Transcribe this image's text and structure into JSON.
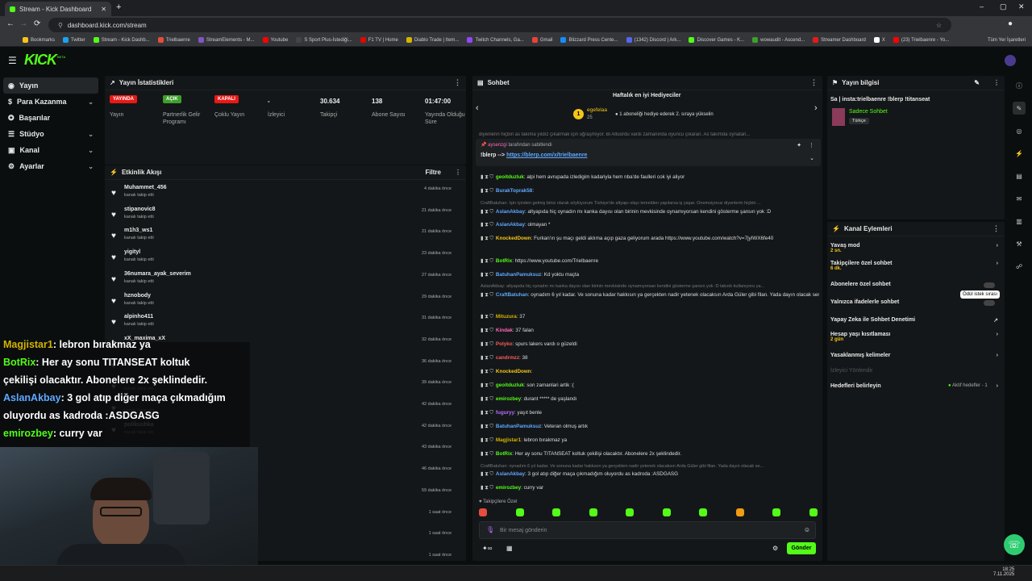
{
  "browser": {
    "tab_title": "Stream - Kick Dashboard",
    "url": "dashboard.kick.com/stream",
    "bookmarks": [
      "Bookmarks",
      "Twitter",
      "Stream - Kick Dashb...",
      "Trielbaenre",
      "StreamElements - M...",
      "Youtube",
      "S Sport Plus-İstediği...",
      "F1 TV | Home",
      "Diablo Trade | Item...",
      "Twitch Channels, Ga...",
      "Gmail",
      "Blizzard Press Cente...",
      "(1342) Discord | Ark...",
      "Discover Games - K...",
      "wowaudit - Ascend...",
      "Streamer Dashboard",
      "X",
      "(23) Trielbaenre - Yo..."
    ],
    "all_bookmarks": "Tüm Yer İşaretleri"
  },
  "brand": {
    "logo": "KICK",
    "beta": "BETA"
  },
  "sidebar": [
    {
      "label": "Yayın"
    },
    {
      "label": "Para Kazanma"
    },
    {
      "label": "Başarılar"
    },
    {
      "label": "Stüdyo"
    },
    {
      "label": "Kanal"
    },
    {
      "label": "Ayarlar"
    }
  ],
  "stats": {
    "title": "Yayın İstatistikleri",
    "items": [
      {
        "badge": "YAYINDA",
        "label": "Yayın",
        "badge_color": "#e91916"
      },
      {
        "badge": "AÇIK",
        "label": "Partnerlik Gelir Programı",
        "badge_color": "#3ea02a"
      },
      {
        "badge": "KAPALI",
        "label": "Çoklu Yayın",
        "badge_color": "#e91916"
      },
      {
        "value": "-",
        "label": "İzleyici"
      },
      {
        "value": "30.634",
        "label": "Takipçi"
      },
      {
        "value": "138",
        "label": "Abone Sayısı"
      },
      {
        "value": "01:47:00",
        "label": "Yayında Olduğu Süre"
      }
    ]
  },
  "events": {
    "title": "Etkinlik Akışı",
    "filter": "Filtre",
    "items": [
      {
        "name": "Muhammet_456",
        "sub": "kanalı takip etti",
        "time": "4 dakika önce"
      },
      {
        "name": "stipanovic8",
        "sub": "kanalı takip etti",
        "time": "21 dakika önce"
      },
      {
        "name": "m1h3_ws1",
        "sub": "kanalı takip etti",
        "time": "21 dakika önce"
      },
      {
        "name": "yigityl",
        "sub": "kanalı takip etti",
        "time": "23 dakika önce"
      },
      {
        "name": "36numara_ayak_severim",
        "sub": "kanalı takip etti",
        "time": "27 dakika önce"
      },
      {
        "name": "hznobody",
        "sub": "kanalı takip etti",
        "time": "29 dakika önce"
      },
      {
        "name": "alpinho411",
        "sub": "kanalı takip etti",
        "time": "31 dakika önce"
      },
      {
        "name": "xX_maxima_xX",
        "sub": "",
        "time": "32 dakika önce"
      },
      {
        "name": "",
        "sub": "",
        "time": "36 dakika önce"
      },
      {
        "name": "",
        "sub": "kanalı takip etti",
        "time": "39 dakika önce"
      },
      {
        "name": "",
        "sub": "kanalı takip etti",
        "time": "42 dakika önce"
      },
      {
        "name": "polikushka",
        "sub": "kanalı takip etti",
        "time": "42 dakika önce"
      },
      {
        "name": "",
        "sub": "",
        "time": "43 dakika önce"
      },
      {
        "name": "",
        "sub": "",
        "time": "46 dakika önce"
      },
      {
        "name": "",
        "sub": "",
        "time": "59 dakika önce"
      },
      {
        "name": "",
        "sub": "",
        "time": "1 saat önce"
      },
      {
        "name": "",
        "sub": "",
        "time": "1 saat önce"
      },
      {
        "name": "",
        "sub": "",
        "time": "1 saat önce"
      }
    ]
  },
  "overlay": [
    {
      "user": "Magjistar1",
      "text": ": lebron bırakmaz ya",
      "color": "#d4b400"
    },
    {
      "user": "BotRix",
      "text": ": Her ay sonu TITANSEAT koltuk",
      "color": "#53fc18"
    },
    {
      "user": "",
      "text": "çekilişi olacaktır. Abonelere 2x şeklindedir.",
      "color": "#fff"
    },
    {
      "user": "AslanAkbay",
      "text": ": 3 gol atıp diğer maça çıkmadığım",
      "color": "#5fa8ff"
    },
    {
      "user": "",
      "text": "oluyordu as kadroda :ASDGASG",
      "color": "#fff"
    },
    {
      "user": "emirozbey",
      "text": ": curry var",
      "color": "#53fc18"
    }
  ],
  "chat": {
    "title": "Sohbet",
    "gifters_title": "Haftalık en iyi Hediyeciler",
    "top_gifter": "egefelaa",
    "top_count": "25",
    "gift_note": "1 aboneliği hediye ederek 2. sıraya yükselin",
    "truncated": "diyenlerin hiçbiri as takıma yıldız çıkarmak için uğraşmıyor. Bi Altuordu vardı zamanında oyuncu çıkaran. As takımda oynatan...",
    "pinned_by": "aysenzgi",
    "pinned_by_suffix": "tarafından sabitlendi",
    "pinned_cmd": "!blerp -->",
    "pinned_link": "https://blerp.com/x/trielbaenre",
    "messages": [
      {
        "u": "geoitduzluk",
        "c": "#53fc18",
        "t": ": alpi hem avrupada izledigim kadariyla hem nba'de faulleri cok iyi aliyor"
      },
      {
        "u": "BurakToprak58",
        "c": "#5fa8ff",
        "t": ":"
      },
      {
        "reply": "CraftBatuhan: İşin içinden gelmiş birisi olarak söylüyorum Türkiye'de altyapı olayı temelden yapılarsa iş yaşar. Önemsiyoruz diyenlerin hiçbiri ..."
      },
      {
        "u": "AslanAkbay",
        "c": "#5fa8ff",
        "t": ": altyapıda hiç oynadın mı kanka dayısı olan birinin mevkisinde oynamıyorsan kendini gösterme şansın yok :D"
      },
      {
        "u": "AslanAkbay",
        "c": "#5fa8ff",
        "t": ": olmayan *"
      },
      {
        "u": "KnockedDown",
        "c": "#f5c518",
        "t": ": Furkan'ın şu maçı geldi aklıma açıp gaza geliyorum arada https://www.youtube.com/watch?v=7jyIWX6fe40"
      },
      {
        "u": "BotRix",
        "c": "#53fc18",
        "t": ": https://www.youtube.com/Trielbaenre"
      },
      {
        "u": "BatuhanPamuksuz",
        "c": "#5fa8ff",
        "t": ": Kd yoktu maçta"
      },
      {
        "reply": "AslanAkbay: altyapıda hiç oynadın mı kanka dayısı olan birinin mevkisinde oynamıyorsan kendini gösterme şansın yok :D lakırdı kullanıyoru ya..."
      },
      {
        "u": "CraftBatuhan",
        "c": "#5fa8ff",
        "t": ": oynadım 6 yıl kadar. Ve sonuna kadar hakkısın ya gerçekten nadir yetenek olacaksın Arda Güler gibi filan. Yada dayın olacak seni kadroda tutacak"
      },
      {
        "u": "Mituzura",
        "c": "#d4b400",
        "t": ": 37"
      },
      {
        "u": "Kindak",
        "c": "#ff6ab4",
        "t": ": 37 falan"
      },
      {
        "u": "Polyko",
        "c": "#ff5a5a",
        "t": ": spurs lakers vardı o güzeldi"
      },
      {
        "u": "candrmzz",
        "c": "#ff5a5a",
        "t": ": 38"
      },
      {
        "u": "KnockedDown",
        "c": "#f5c518",
        "t": ":"
      },
      {
        "u": "geoitduzluk",
        "c": "#53fc18",
        "t": ": son zamanlari artik :("
      },
      {
        "u": "emirozbey",
        "c": "#53fc18",
        "t": ": durant ***** de yaşlandı"
      },
      {
        "u": "fuguryy",
        "c": "#b86bff",
        "t": ": yaşıt benle"
      },
      {
        "u": "BatuhanPamuksuz",
        "c": "#5fa8ff",
        "t": ": Veteran olmuş artık"
      },
      {
        "u": "Magjistar1",
        "c": "#d4b400",
        "t": ": lebron bırakmaz ya"
      },
      {
        "u": "BotRix",
        "c": "#53fc18",
        "t": ": Her ay sonu TITANSEAT koltuk çekilişi olacaktır. Abonelere 2x şeklindedir."
      },
      {
        "reply": "CraftBatuhan: oynadım 6 yıl kadar. Ve sonuna kadar hakkısın ya gerçekten nadir yetenek olacaksın Arda Güler gibi filan. Yada dayın olacak se..."
      },
      {
        "u": "AslanAkbay",
        "c": "#5fa8ff",
        "t": ": 3 gol atıp diğer maça çıkmadığım oluyordu as kadroda :ASDGASG"
      },
      {
        "u": "emirozbey",
        "c": "#53fc18",
        "t": ": curry var"
      }
    ],
    "followers_only": "Takipçilere Özel",
    "input_placeholder": "Bir mesaj gönderin",
    "send": "Gönder"
  },
  "stream_info": {
    "title": "Yayın bilgisi",
    "stream_title": "Sa | insta:trielbaenre !blerp !titanseat",
    "category": "Sadece Sohbet",
    "language": "Türkçe"
  },
  "actions": {
    "title": "Kanal Eylemleri",
    "items": [
      {
        "label": "Yavaş mod",
        "sub": "2 sn."
      },
      {
        "label": "Takipçilere özel sohbet",
        "sub": "6 dk."
      },
      {
        "label": "Abonelere özel sohbet",
        "sub": ""
      },
      {
        "label": "Yalnızca ifadelerle sohbet",
        "sub": ""
      },
      {
        "label": "Yapay Zeka ile Sohbet Denetimi",
        "sub": ""
      },
      {
        "label": "Hesap yaşı kısıtlaması",
        "sub": "2 gün"
      },
      {
        "label": "Yasaklanmış kelimeler",
        "sub": ""
      },
      {
        "label": "İzleyici Yönlendir",
        "sub": ""
      },
      {
        "label": "Hedefleri belirleyin",
        "sub": ""
      }
    ],
    "tooltip": "Ödül istek sırası",
    "goals_status": "Aktif hedefler - 1"
  },
  "taskbar": {
    "time": "18:25",
    "date": "7.11.2025"
  }
}
